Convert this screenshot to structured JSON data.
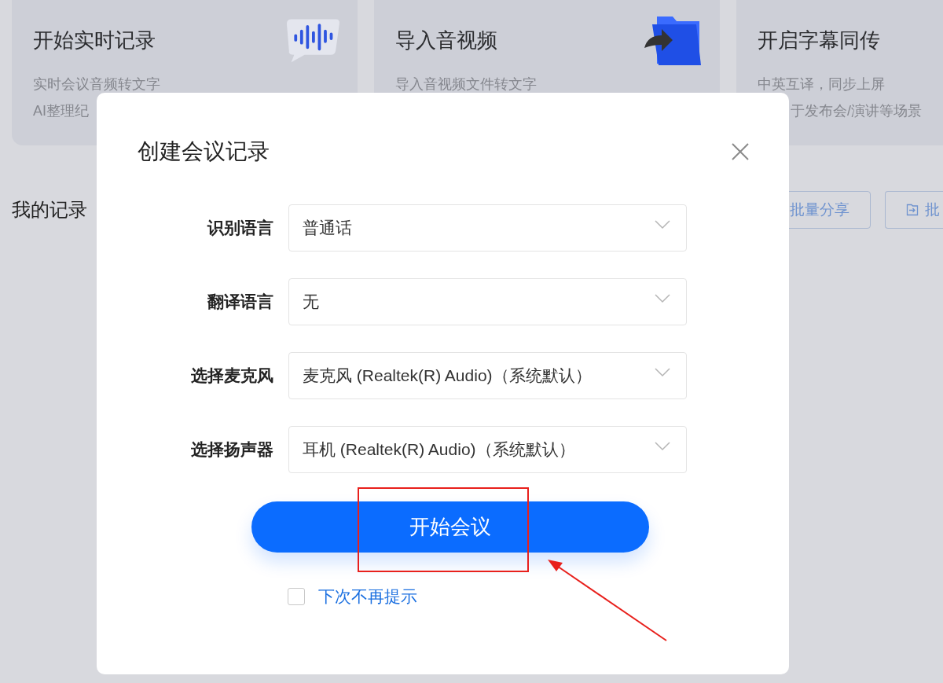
{
  "feature_cards": [
    {
      "kind": "wave",
      "title": "开始实时记录",
      "lines": [
        "实时会议音频转文字",
        "AI整理纪"
      ]
    },
    {
      "kind": "folder",
      "title": "导入音视频",
      "lines": [
        "导入音视频文件转文字"
      ]
    },
    {
      "kind": "none",
      "title": "开启字幕同传",
      "lines": [
        "中英互译，同步上屏",
        "于发布会/演讲等场景"
      ]
    }
  ],
  "section_title": "我的记录",
  "toolbar_buttons": [
    {
      "kind": "text",
      "label": "批量分享"
    },
    {
      "kind": "icon",
      "label": "批"
    }
  ],
  "dialog": {
    "title": "创建会议记录",
    "fields": [
      {
        "label": "识别语言",
        "value": "普通话"
      },
      {
        "label": "翻译语言",
        "value": "无"
      },
      {
        "label": "选择麦克风",
        "value": "麦克风 (Realtek(R) Audio)（系统默认）"
      },
      {
        "label": "选择扬声器",
        "value": "耳机 (Realtek(R) Audio)（系统默认）"
      }
    ],
    "primary_button": "开始会议",
    "dont_show_again": {
      "label": "下次不再提示",
      "checked": false
    }
  }
}
